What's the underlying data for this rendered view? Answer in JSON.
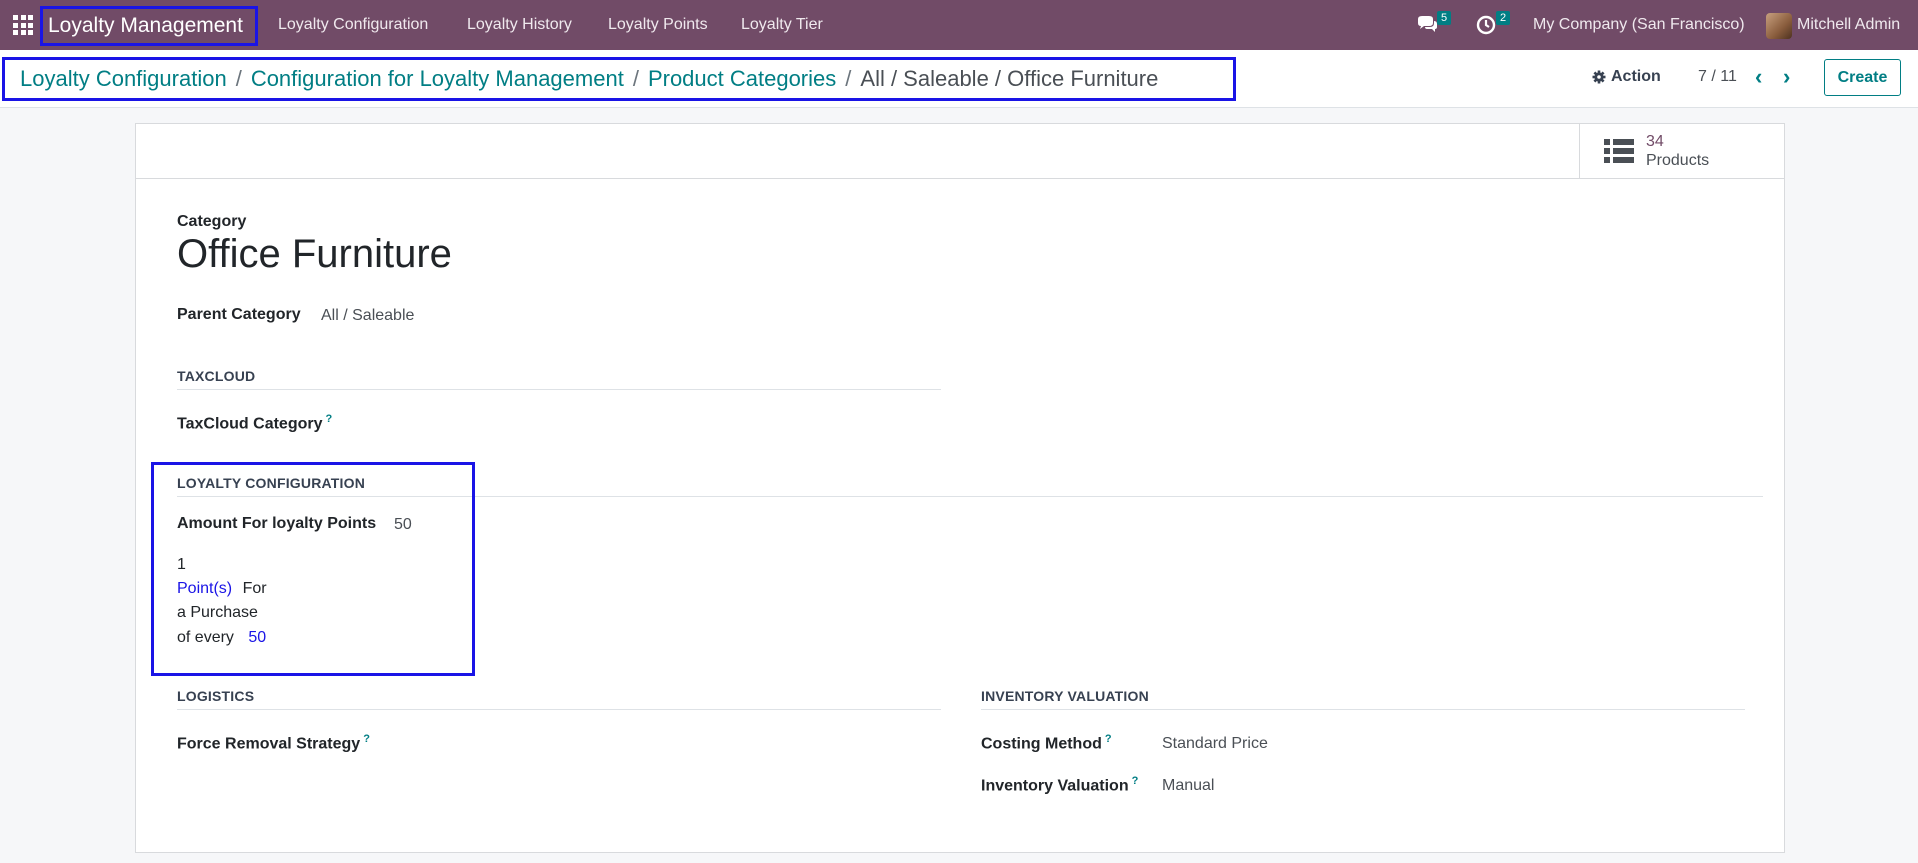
{
  "navbar": {
    "app_name": "Loyalty Management",
    "menu": [
      "Loyalty Configuration",
      "Loyalty History",
      "Loyalty Points",
      "Loyalty Tier"
    ],
    "messages_count": "5",
    "activities_count": "2",
    "company": "My Company (San Francisco)",
    "user": "Mitchell Admin"
  },
  "breadcrumb": {
    "items": [
      "Loyalty Configuration",
      "Configuration for Loyalty Management",
      "Product Categories"
    ],
    "separator": "/",
    "active": "All / Saleable / Office Furniture"
  },
  "control": {
    "action_label": "Action",
    "pager": "7 / 11",
    "create_label": "Create"
  },
  "stat_button": {
    "value": "34",
    "label": "Products"
  },
  "form": {
    "category_label": "Category",
    "title": "Office Furniture",
    "parent_label": "Parent Category",
    "parent_value": "All / Saleable",
    "taxcloud_section": "TAXCLOUD",
    "taxcloud_label": "TaxCloud Category",
    "loyalty_section": "LOYALTY CONFIGURATION",
    "amount_label": "Amount For loyalty Points",
    "amount_value": "50",
    "points_value": "1",
    "points_unit": "Point(s)",
    "for_text": "For",
    "purchase_text": "a Purchase",
    "every_text": "of every",
    "every_value": "50",
    "logistics_section": "LOGISTICS",
    "removal_label": "Force Removal Strategy",
    "inventory_section": "INVENTORY VALUATION",
    "costing_label": "Costing Method",
    "costing_value": "Standard Price",
    "valuation_label": "Inventory Valuation",
    "valuation_value": "Manual",
    "help_mark": "?"
  },
  "colors": {
    "navbar": "#714b67",
    "accent": "#017e84",
    "highlight": "#1a14e6"
  }
}
